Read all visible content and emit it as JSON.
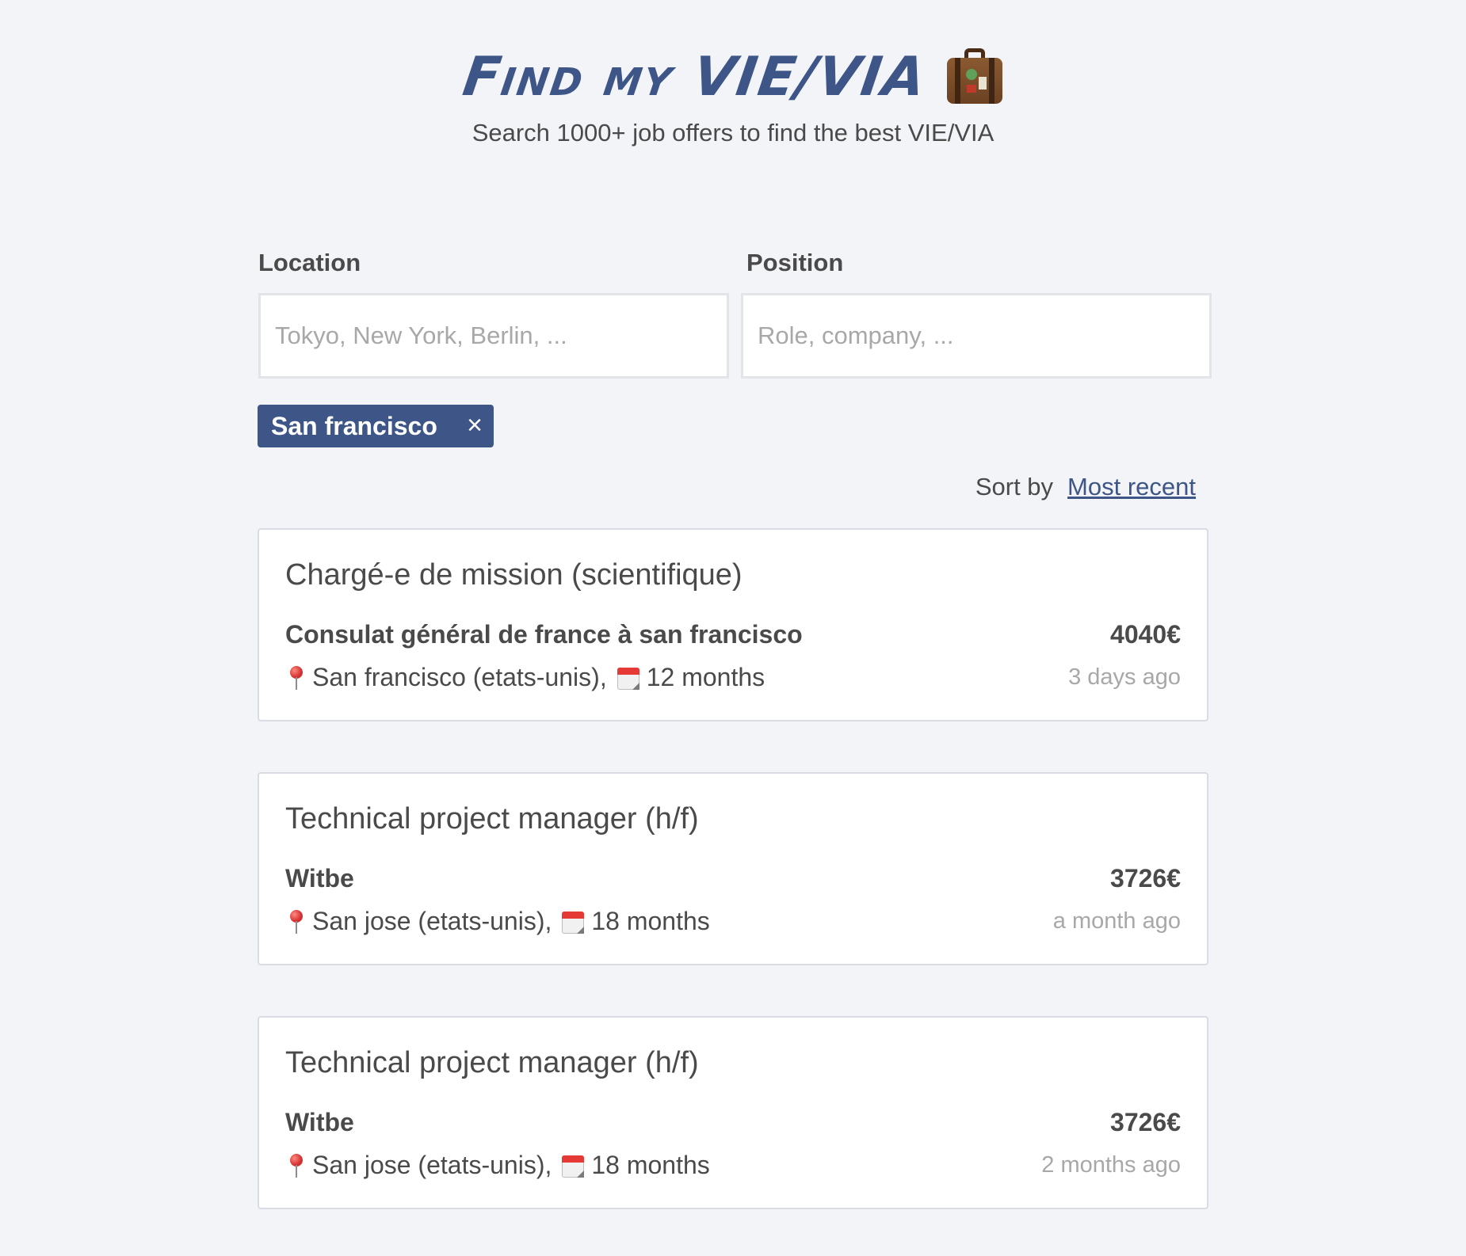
{
  "header": {
    "title": "Find my VIE/VIA",
    "subtitle": "Search 1000+ job offers to find the best VIE/VIA",
    "icon": "suitcase-icon"
  },
  "search": {
    "location_label": "Location",
    "location_placeholder": "Tokyo, New York, Berlin, ...",
    "location_value": "",
    "position_label": "Position",
    "position_placeholder": "Role, company, ...",
    "position_value": ""
  },
  "filters": {
    "active_tag": "San francisco",
    "remove_icon": "×"
  },
  "sort": {
    "label": "Sort by",
    "value": "Most recent"
  },
  "offers": [
    {
      "title": "Chargé-e de mission (scientifique)",
      "company": "Consulat général de france à san francisco",
      "salary": "4040€",
      "location": "San francisco (etats-unis),",
      "duration": "12 months",
      "posted": "3 days ago"
    },
    {
      "title": "Technical project manager (h/f)",
      "company": "Witbe",
      "salary": "3726€",
      "location": "San jose (etats-unis),",
      "duration": "18 months",
      "posted": "a month ago"
    },
    {
      "title": "Technical project manager (h/f)",
      "company": "Witbe",
      "salary": "3726€",
      "location": "San jose (etats-unis),",
      "duration": "18 months",
      "posted": "2 months ago"
    }
  ],
  "colors": {
    "accent": "#3d5587",
    "background": "#f3f4f8",
    "text": "#4a4a4a",
    "muted": "#a8a8a8"
  }
}
